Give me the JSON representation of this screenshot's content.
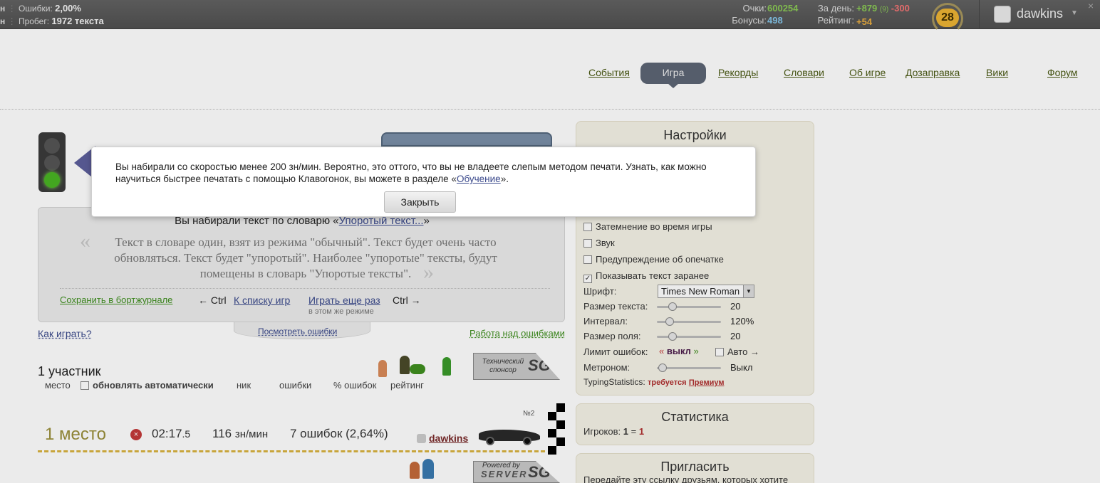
{
  "topbar": {
    "left_row1_prefix": "н",
    "left_row2_prefix": "н",
    "errors_label": "Ошибки:",
    "errors_value": "2,00%",
    "mileage_label": "Пробег:",
    "mileage_value": "1972 текста",
    "points_label": "Очки:",
    "points_value": "600254",
    "bonuses_label": "Бонусы:",
    "bonuses_value": "498",
    "per_day_label": "За день:",
    "per_day_plus": "+879",
    "per_day_count": "(9)",
    "per_day_minus": "-300",
    "rating_label": "Рейтинг:",
    "rating_value": "+54",
    "level": "28",
    "username": "dawkins",
    "close_glyph": "×"
  },
  "nav": {
    "items": [
      "События",
      "Игра",
      "Рекорды",
      "Словари",
      "Об игре",
      "Дозаправка",
      "Вики",
      "Форум"
    ],
    "active": "Игра"
  },
  "modal": {
    "text_before_link": "Вы набирали со скоростью менее 200 зн/мин. Вероятно, это оттого, что вы не владеете слепым методом печати. Узнать, как можно научиться быстрее печатать с помощью Клавогонок, вы можете в разделе «",
    "link": "Обучение",
    "text_after_link": "».",
    "close_button": "Закрыть"
  },
  "dict": {
    "title_prefix": "Вы набирали текст по словарю «",
    "title_link": "Упоротый текст...",
    "title_suffix": "»",
    "description": "Текст в словаре один, взят из режима \"обычный\". Текст будет очень часто обновляться. Текст будет \"упоротый\". Наиболее \"упоротые\" тексты, будут помещены в словарь \"Упоротые тексты\".",
    "save_link": "Сохранить в бортжурнале",
    "ctrl_left": "← Ctrl",
    "back_link": "К списку игр",
    "replay_link": "Играть еще раз",
    "ctrl_right": "Ctrl →",
    "same_mode": "в этом же режиме",
    "view_errors": "Посмотреть ошибки",
    "how_to_play": "Как играть?",
    "work_on_errors": "Работа над ошибками"
  },
  "participants": {
    "count_label": "1 участник",
    "columns": [
      "место",
      "обновлять автоматически",
      "ник",
      "ошибки",
      "% ошибок",
      "рейтинг"
    ],
    "sponsor_tech": "Технический спонсор",
    "sponsor_logo": "SG",
    "powered_by": "Powered by",
    "server": "SERVER"
  },
  "result": {
    "place": "1 место",
    "time_main": "02:17",
    "time_frac": ".5",
    "speed": "116",
    "speed_unit": "зн/мин",
    "errors": "7 ошибок (2,64%)",
    "player": "dawkins",
    "car_no": "№2"
  },
  "settings": {
    "title": "Настройки",
    "checkboxes": [
      {
        "label": "Затемнение во время игры",
        "checked": false
      },
      {
        "label": "Звук",
        "checked": false
      },
      {
        "label": "Предупреждение об опечатке",
        "checked": false
      },
      {
        "label": "Показывать текст заранее",
        "checked": true
      }
    ],
    "font_label": "Шрифт:",
    "font_value": "Times New Roman",
    "text_size_label": "Размер текста:",
    "text_size_value": "20",
    "interval_label": "Интервал:",
    "interval_value": "120%",
    "field_size_label": "Размер поля:",
    "field_size_value": "20",
    "error_limit_label": "Лимит ошибок:",
    "error_limit_value": "выкл",
    "auto_label": "Авто →",
    "metronome_label": "Метроном:",
    "metronome_value": "Выкл",
    "typing_stats_label": "TypingStatistics:",
    "typing_stats_required": "требуется",
    "typing_stats_premium": "Премиум"
  },
  "stats": {
    "title": "Статистика",
    "players_label": "Игроков:",
    "players_a": "1",
    "players_eq": "=",
    "players_b": "1"
  },
  "invite": {
    "title": "Пригласить",
    "text": "Передайте эту ссылку друзьям, которых хотите"
  }
}
